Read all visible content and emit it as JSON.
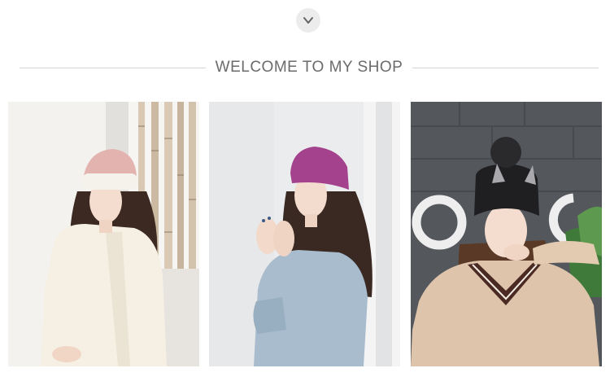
{
  "shop": {
    "expand_icon": "chevron-down-icon",
    "title": "WELCOME TO MY SHOP"
  },
  "photos": [
    {
      "subject": "model-pink-white-beanie"
    },
    {
      "subject": "model-purple-beanie"
    },
    {
      "subject": "model-black-cat-ear-pompom-beanie"
    }
  ]
}
